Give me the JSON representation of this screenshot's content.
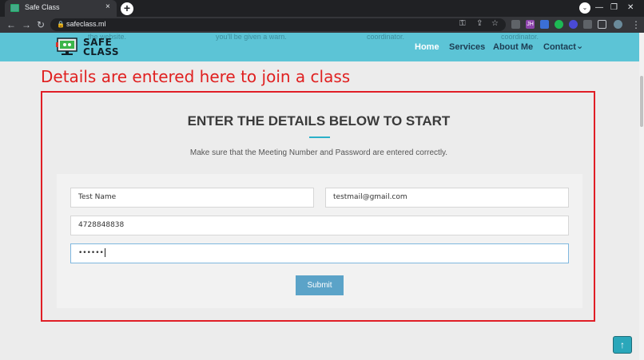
{
  "browser": {
    "tab_title": "Safe Class",
    "tab_close": "×",
    "new_tab": "+",
    "minimize": "—",
    "restore": "❐",
    "close": "✕",
    "tab_search": "⌄",
    "back": "←",
    "forward": "→",
    "reload": "↻",
    "lock": "🔒",
    "url": "safeclass.ml",
    "key": "⚿",
    "share": "⇪",
    "star": "☆",
    "ext_jh": "JH",
    "menu": "⋮"
  },
  "header": {
    "ghost_texts": [
      "the website.",
      "you'll be given a warn.",
      "coordinator.",
      "coordinator."
    ],
    "logo_line1": "SAFE",
    "logo_line2": "CLASS",
    "nav": [
      "Home",
      "Services",
      "About Me",
      "Contact"
    ],
    "contact_chevron": "⌄"
  },
  "annotation": "Details are entered here to join a class",
  "form": {
    "heading": "ENTER THE DETAILS BELOW TO START",
    "subtitle": "Make sure that the Meeting Number and Password are entered correctly.",
    "name_value": "Test Name",
    "email_value": "testmail@gmail.com",
    "meeting_number": "4728848838",
    "password_masked": "••••••",
    "submit_label": "Submit"
  },
  "scroll_top_icon": "↑"
}
